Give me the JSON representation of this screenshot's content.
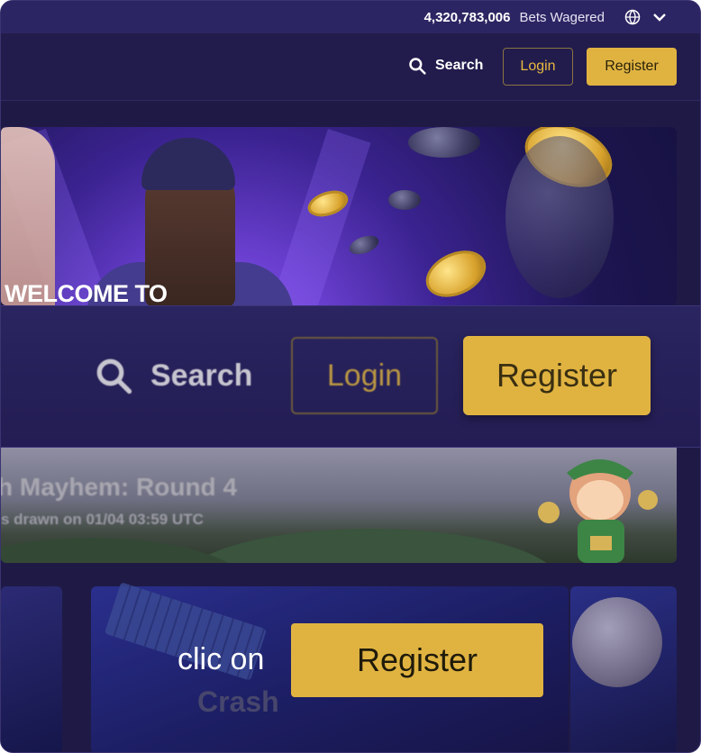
{
  "stats": {
    "bets_wagered_value": "4,320,783,006",
    "bets_wagered_label": "Bets Wagered"
  },
  "header": {
    "search_label": "Search",
    "login_label": "Login",
    "register_label": "Register"
  },
  "hero": {
    "headline": "WELCOME TO"
  },
  "zoom": {
    "search_label": "Search",
    "login_label": "Login",
    "register_label": "Register"
  },
  "promo": {
    "title": "h Mayhem: Round 4",
    "subtitle": "s drawn on 01/04 03:59 UTC"
  },
  "games": {
    "tile_title": "Crash"
  },
  "instruction": {
    "text": "clic on",
    "button_label": "Register"
  },
  "colors": {
    "accent_gold": "#e0b341",
    "bg_dark": "#1f1a45",
    "bar_purple": "#2c2563"
  },
  "icons": {
    "search": "search-icon",
    "globe": "globe-icon",
    "dropdown": "chevron-down-icon"
  }
}
